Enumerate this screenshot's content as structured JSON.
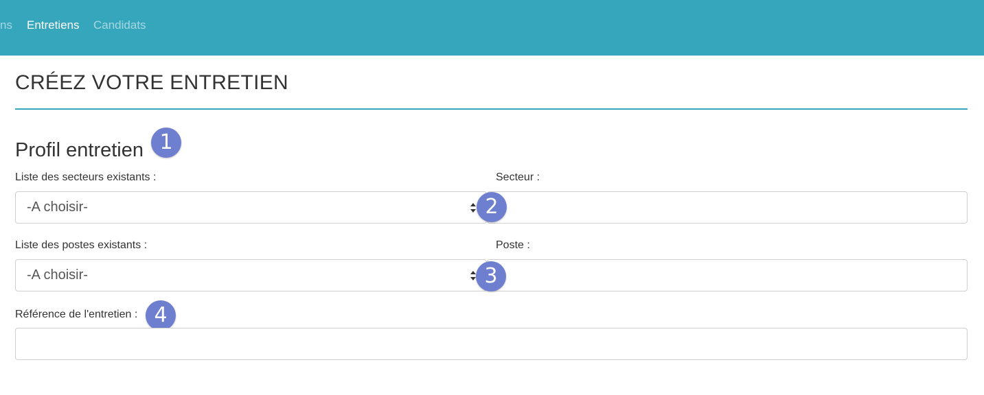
{
  "nav": {
    "items": [
      {
        "label": "ns",
        "active": false
      },
      {
        "label": "Entretiens",
        "active": true
      },
      {
        "label": "Candidats",
        "active": false
      }
    ],
    "bar_color": "#36a6bc"
  },
  "page": {
    "title": "CRÉEZ VOTRE ENTRETIEN"
  },
  "section": {
    "title": "Profil entretien"
  },
  "form": {
    "secteurs_list_label": "Liste des secteurs existants :",
    "secteurs_list_value": "-A choisir-",
    "secteur_label": "Secteur :",
    "secteur_value": "",
    "postes_list_label": "Liste des postes existants :",
    "postes_list_value": "-A choisir-",
    "poste_label": "Poste :",
    "poste_value": "",
    "reference_label": "Référence de l'entretien :",
    "reference_value": ""
  },
  "annotations": {
    "badges": [
      "1",
      "2",
      "3",
      "4"
    ],
    "color": "#6f7fcf"
  }
}
